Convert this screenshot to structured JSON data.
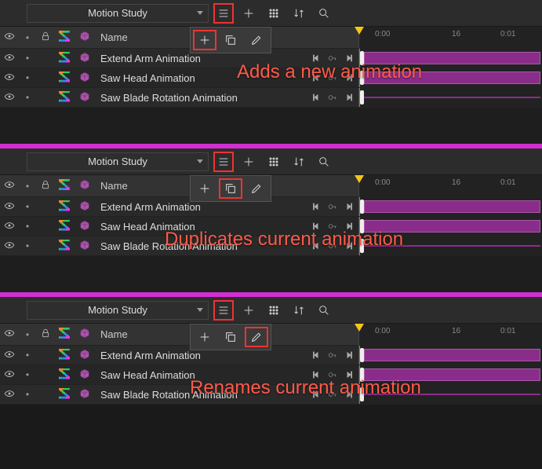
{
  "dropdown_label": "Motion Study",
  "name_header": "Name",
  "ruler": {
    "t0": "0:00",
    "t1": "16",
    "t2": "0:01"
  },
  "rows": [
    {
      "name": "Extend Arm Animation"
    },
    {
      "name": "Saw Head Animation"
    },
    {
      "name": "Saw Blade Rotation Animation"
    }
  ],
  "annotations": {
    "add": "Adds a new animation",
    "dup": "Duplicates current animation",
    "ren": "Renames current animation"
  }
}
